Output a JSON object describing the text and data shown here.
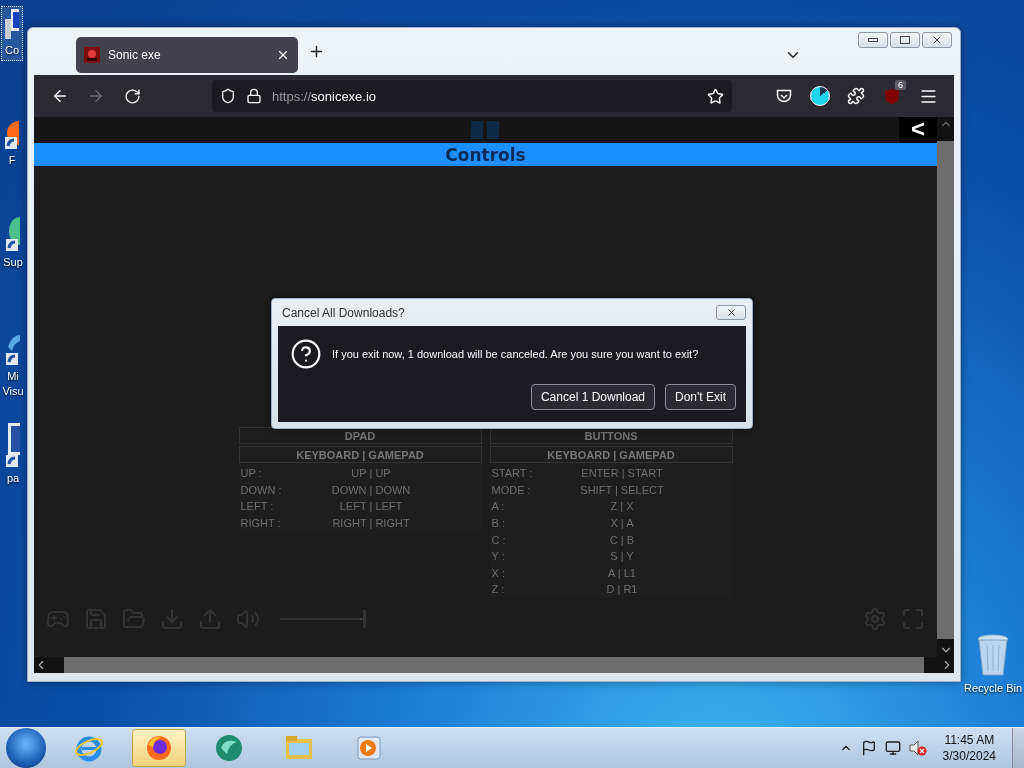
{
  "desktop_icons": [
    {
      "kind": "computer",
      "label": "Co",
      "selected": true
    },
    {
      "kind": "firefox",
      "label": "F",
      "selected": false
    },
    {
      "kind": "globe",
      "label": "Sup",
      "selected": false
    },
    {
      "kind": "swirl",
      "label": "Mi Visu",
      "selected": false
    },
    {
      "kind": "file",
      "label": "pa",
      "selected": false
    },
    {
      "kind": "recycle",
      "label": "Recycle Bin",
      "selected": false
    }
  ],
  "browser": {
    "tabs": [
      {
        "title": "Sonic exe",
        "selected": true
      }
    ],
    "url": {
      "scheme": "https://",
      "host": "sonicexe.io"
    },
    "forward_disabled": true,
    "extension_badge": "6"
  },
  "page": {
    "side_toggle": "<",
    "title": "Controls",
    "tables": [
      {
        "title": "DPAD",
        "subtitle": "KEYBOARD | GAMEPAD",
        "rows": [
          {
            "key": "UP :",
            "value": "UP | UP"
          },
          {
            "key": "DOWN :",
            "value": "DOWN | DOWN"
          },
          {
            "key": "LEFT :",
            "value": "LEFT | LEFT"
          },
          {
            "key": "RIGHT :",
            "value": "RIGHT | RIGHT"
          }
        ]
      },
      {
        "title": "BUTTONS",
        "subtitle": "KEYBOARD | GAMEPAD",
        "rows": [
          {
            "key": "START :",
            "value": "ENTER | START"
          },
          {
            "key": "MODE :",
            "value": "SHIFT | SELECT"
          },
          {
            "key": "A :",
            "value": "Z | X"
          },
          {
            "key": "B :",
            "value": "X | A"
          },
          {
            "key": "C :",
            "value": "C | B"
          },
          {
            "key": "Y :",
            "value": "S | Y"
          },
          {
            "key": "X :",
            "value": "A | L1"
          },
          {
            "key": "Z :",
            "value": "D | R1"
          }
        ]
      }
    ],
    "volume": {
      "level": 1
    }
  },
  "dialog": {
    "title": "Cancel All Downloads?",
    "message": "If you exit now, 1 download will be canceled. Are you sure you want to exit?",
    "buttons": [
      "Cancel 1 Download",
      "Don't Exit"
    ]
  },
  "taskbar": {
    "apps": [
      {
        "kind": "ie",
        "selected": false
      },
      {
        "kind": "firefox",
        "selected": true
      },
      {
        "kind": "swirl",
        "selected": false
      },
      {
        "kind": "explorer",
        "selected": false
      },
      {
        "kind": "media",
        "selected": false
      }
    ],
    "time": "11:45 AM",
    "date": "3/30/2024"
  }
}
